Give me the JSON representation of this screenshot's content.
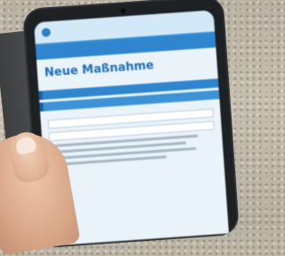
{
  "phone_screen": {
    "header": {
      "brand_text": ""
    },
    "nav": {
      "items": [
        "",
        ""
      ]
    },
    "page": {
      "breadcrumb": "",
      "title": "Neue Maßnahme",
      "subtitle": ""
    },
    "sections": [
      "",
      ""
    ],
    "fields": [
      {
        "label": "",
        "value": ""
      },
      {
        "label": "",
        "value": ""
      }
    ],
    "footer_link": ""
  },
  "colors": {
    "accent": "#2f86cf",
    "title": "#1f6fb5",
    "screen_bg": "#eaf3f9",
    "phone_body": "#1e2124"
  }
}
